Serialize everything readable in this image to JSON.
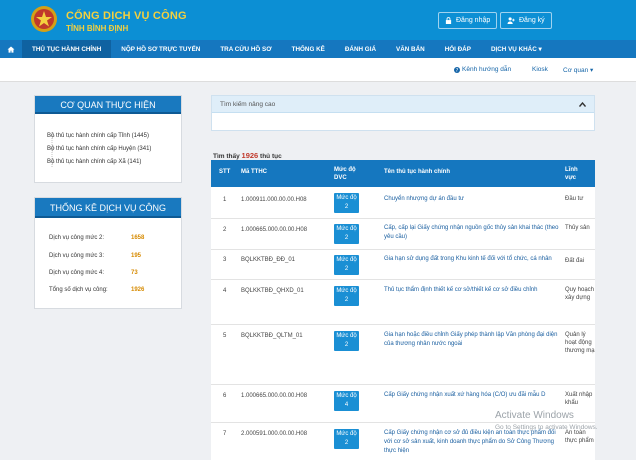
{
  "header": {
    "brand_title": "CỔNG DỊCH VỤ CÔNG",
    "brand_subtitle": "TỈNH BÌNH ĐỊNH",
    "login_label": "Đăng nhập",
    "register_label": "Đăng ký"
  },
  "nav": {
    "items": [
      "THỦ TỤC HÀNH CHÍNH",
      "NỘP HỒ SƠ TRỰC TUYẾN",
      "TRA CỨU HỒ SƠ",
      "THỐNG KÊ",
      "ĐÁNH GIÁ",
      "VĂN BẢN",
      "HỎI ĐÁP",
      "DỊCH VỤ KHÁC ▾"
    ]
  },
  "subbar": {
    "guide": "Kênh hướng dẫn",
    "kiosk": "Kiosk",
    "portal": "Cơ quan ▾"
  },
  "agencies": {
    "title": "CƠ QUAN THỰC HIỆN",
    "items": [
      "Bộ thủ tục hành chính cấp Tỉnh (1445)",
      "Bộ thủ tục hành chính cấp Huyện (341)",
      "Bộ thủ tục hành chính cấp Xã (141)"
    ]
  },
  "stats": {
    "title": "THỐNG KÊ DỊCH VỤ CÔNG",
    "rows": [
      {
        "label": "Dịch vụ công mức 2:",
        "value": "1658"
      },
      {
        "label": "Dịch vụ công mức 3:",
        "value": "195"
      },
      {
        "label": "Dịch vụ công mức 4:",
        "value": "73"
      },
      {
        "label": "Tổng số dịch vụ công:",
        "value": "1926"
      }
    ]
  },
  "search": {
    "title": "Tìm kiếm nâng cao"
  },
  "results": {
    "prefix": "Tìm thấy",
    "count": "1926",
    "suffix": "thủ tục"
  },
  "table": {
    "headers": {
      "stt": "STT",
      "code": "Mã TTHC",
      "level": "Mức độ DVC",
      "name": "Tên thủ tục hành chính",
      "field": "Lĩnh vực"
    },
    "rows": [
      {
        "stt": "1",
        "code": "1.000911.000.00.00.H08",
        "level": "Mức độ 2",
        "name": "Chuyển nhượng dự án đầu tư",
        "field": "Đầu tư"
      },
      {
        "stt": "2",
        "code": "1.000665.000.00.00.H08",
        "level": "Mức độ 2",
        "name": "Cấp, cấp lại Giấy chứng nhận nguồn gốc thủy sản khai thác (theo yêu cầu)",
        "field": "Thủy sản"
      },
      {
        "stt": "3",
        "code": "BQLKKTBĐ_ĐĐ_01",
        "level": "Mức độ 2",
        "name": "Gia hạn sử dụng đất trong Khu kinh tế đối với tổ chức, cá nhân",
        "field": "Đất đai"
      },
      {
        "stt": "4",
        "code": "BQLKKTBĐ_QHXD_01",
        "level": "Mức độ 2",
        "name": "Thủ tục thẩm định thiết kế cơ sở/thiết kế cơ sở điều chỉnh",
        "field": "Quy hoạch xây dựng"
      },
      {
        "stt": "5",
        "code": "BQLKKTBĐ_QLTM_01",
        "level": "Mức độ 2",
        "name": "Gia hạn hoặc điều chỉnh Giấy phép thành lập Văn phòng đại diện của thương nhân nước ngoài",
        "field": "Quản lý hoạt động thương mại"
      },
      {
        "stt": "6",
        "code": "1.000665.000.00.00.H08",
        "level": "Mức độ 4",
        "name": "Cấp Giấy chứng nhận xuất xứ hàng hóa (C/O) ưu đãi mẫu D",
        "field": "Xuất nhập khẩu"
      },
      {
        "stt": "7",
        "code": "2.000591.000.00.00.H08",
        "level": "Mức độ 2",
        "name": "Cấp Giấy chứng nhận cơ sở đủ điều kiện an toàn thực phẩm đối với cơ sở sản xuất, kinh doanh thực phẩm do Sở Công Thương thực hiện",
        "field": "An toàn thực phẩm"
      }
    ]
  },
  "watermark": {
    "line1": "Activate Windows",
    "line2": "Go to Settings to activate Windows."
  },
  "colors": {
    "primary": "#0c8fd4",
    "nav": "#1577bf",
    "brand_text": "#f4d03f",
    "stat_value": "#d68a00"
  }
}
